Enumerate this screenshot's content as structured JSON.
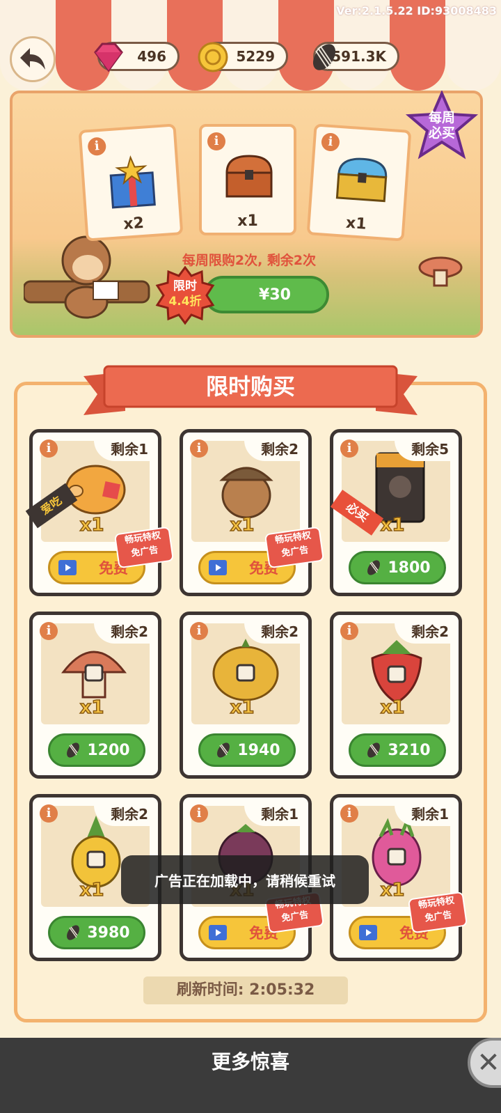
{
  "version": "Ver:2.1.5.22 ID:93008483",
  "resources": {
    "gems": "496",
    "coins": "5229",
    "seeds": "591.3K"
  },
  "weekly": {
    "badge": [
      "每周",
      "必买"
    ],
    "rewards": [
      {
        "icon": "gift-box-icon",
        "qty": "x2"
      },
      {
        "icon": "wooden-chest-icon",
        "qty": "x1"
      },
      {
        "icon": "golden-chest-icon",
        "qty": "x1"
      }
    ],
    "note": "每周限购2次, 剩余2次",
    "discount": [
      "限时",
      "4.4折"
    ],
    "price": "¥30"
  },
  "limited": {
    "title": "限时购买",
    "items": [
      {
        "icon": "piggy-bank-icon",
        "remain": "剩余1",
        "qty": "x1",
        "button": "free",
        "label": "免费",
        "adfree": [
          "畅玩特权",
          "免广告"
        ],
        "ribbon": "爱吃"
      },
      {
        "icon": "acorn-icon",
        "remain": "剩余2",
        "qty": "x1",
        "button": "free",
        "label": "免费",
        "adfree": [
          "畅玩特权",
          "免广告"
        ]
      },
      {
        "icon": "seed-bag-icon",
        "remain": "剩余5",
        "qty": "x1",
        "button": "price",
        "label": "1800",
        "ribbon": "必买"
      },
      {
        "icon": "mushroom-icon",
        "remain": "剩余2",
        "qty": "x1",
        "button": "price",
        "label": "1200"
      },
      {
        "icon": "pumpkin-icon",
        "remain": "剩余2",
        "qty": "x1",
        "button": "price",
        "label": "1940"
      },
      {
        "icon": "strawberry-icon",
        "remain": "剩余2",
        "qty": "x1",
        "button": "price",
        "label": "3210"
      },
      {
        "icon": "pineapple-icon",
        "remain": "剩余2",
        "qty": "x1",
        "button": "price",
        "label": "3980"
      },
      {
        "icon": "mangosteen-icon",
        "remain": "剩余1",
        "qty": "x1",
        "button": "free",
        "label": "免费",
        "adfree": [
          "畅玩特权",
          "免广告"
        ]
      },
      {
        "icon": "dragon-fruit-icon",
        "remain": "剩余1",
        "qty": "x1",
        "button": "free",
        "label": "免费",
        "adfree": [
          "畅玩特权",
          "免广告"
        ]
      }
    ],
    "refresh": "刷新时间: 2:05:32"
  },
  "toast": "广告正在加载中，请稍候重试",
  "more": "更多惊喜",
  "colors": {
    "accent_green": "#55b043",
    "accent_red": "#e0523c",
    "gold": "#f6c53a",
    "panel_border": "#f3b26e"
  }
}
